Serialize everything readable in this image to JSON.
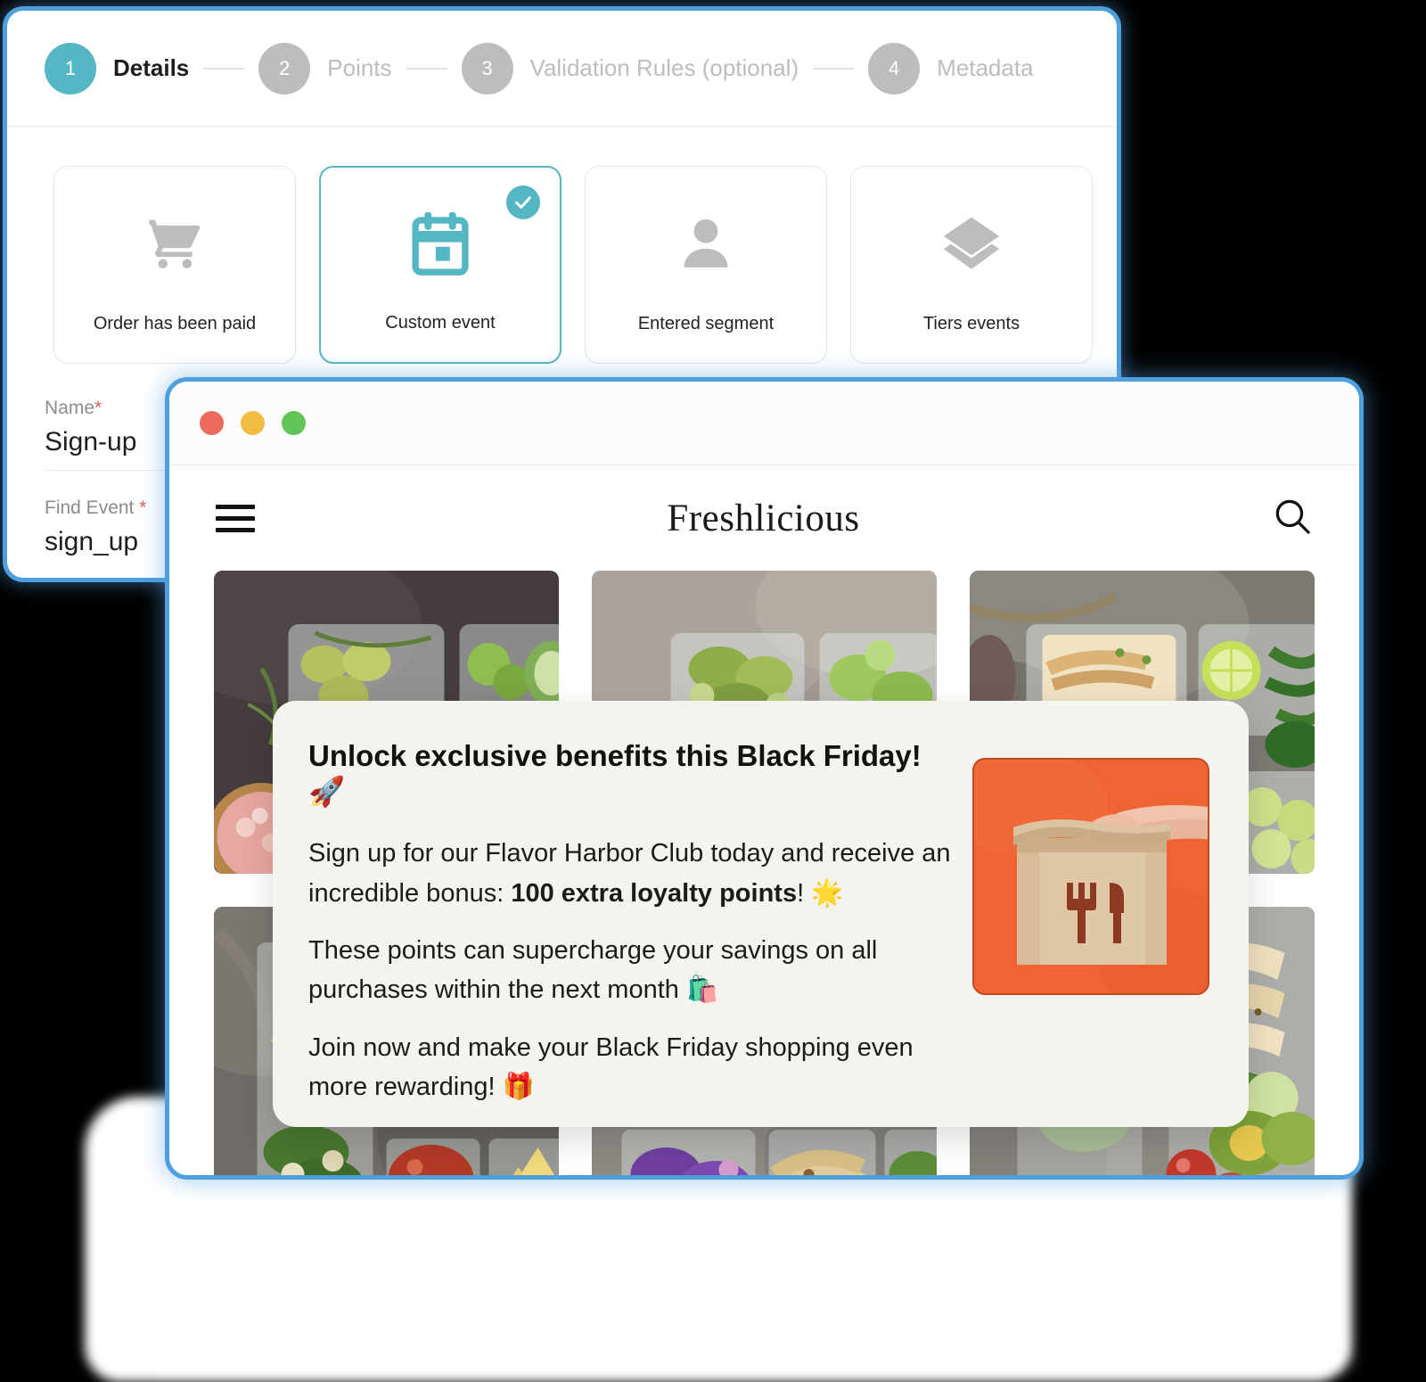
{
  "wizard": {
    "steps": [
      {
        "number": "1",
        "label": "Details",
        "active": true
      },
      {
        "number": "2",
        "label": "Points",
        "active": false
      },
      {
        "number": "3",
        "label": "Validation Rules (optional)",
        "active": false
      },
      {
        "number": "4",
        "label": "Metadata",
        "active": false
      }
    ],
    "event_cards": [
      {
        "label": "Order has been paid",
        "icon": "shopping-cart-icon",
        "selected": false
      },
      {
        "label": "Custom event",
        "icon": "calendar-icon",
        "selected": true
      },
      {
        "label": "Entered segment",
        "icon": "person-icon",
        "selected": false
      },
      {
        "label": "Tiers events",
        "icon": "layers-icon",
        "selected": false
      }
    ],
    "fields": [
      {
        "label": "Name",
        "required": "*",
        "value": "Sign-up"
      },
      {
        "label": "Find Event",
        "required": "*",
        "value": "sign_up"
      }
    ],
    "accent_color": "#55b6c4",
    "required_color": "#e05b5b"
  },
  "browser": {
    "traffic_lights": [
      "close",
      "minimize",
      "maximize"
    ],
    "site": {
      "brand": "Freshlicious",
      "menu_icon": "hamburger-menu-icon",
      "search_icon": "search-icon"
    }
  },
  "modal": {
    "title": "Unlock exclusive benefits this Black Friday! 🚀",
    "paragraphs": [
      {
        "segments": [
          {
            "text": "Sign up for our Flavor Harbor Club today and receive an incredible bonus: ",
            "bold": false
          },
          {
            "text": "100 extra loyalty points",
            "bold": true
          },
          {
            "text": "! 🌟",
            "bold": false
          }
        ]
      },
      {
        "segments": [
          {
            "text": "These points can supercharge your savings on all purchases within the next month 🛍️",
            "bold": false
          }
        ]
      },
      {
        "segments": [
          {
            "text": "Join now and make your Black Friday shopping even more rewarding! 🎁",
            "bold": false
          }
        ]
      }
    ],
    "image": {
      "name": "takeout-bag-photo",
      "background_color": "#ef6432",
      "border_color": "#c04a22",
      "logo_color": "#8c3b22"
    },
    "background_color": "#f4f3ee"
  }
}
